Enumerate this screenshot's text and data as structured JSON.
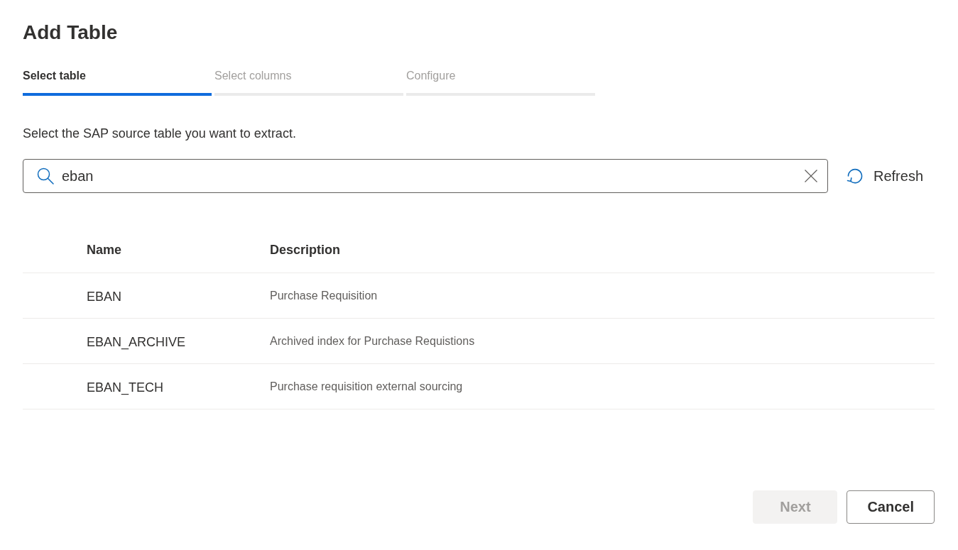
{
  "dialog": {
    "title": "Add Table"
  },
  "steps": [
    {
      "label": "Select table",
      "selected": true
    },
    {
      "label": "Select columns",
      "selected": false
    },
    {
      "label": "Configure",
      "selected": false
    }
  ],
  "instruction": "Select the SAP source table you want to extract.",
  "search": {
    "value": "eban"
  },
  "refresh_button": {
    "label": "Refresh"
  },
  "table": {
    "columns": [
      "Name",
      "Description"
    ],
    "rows": [
      {
        "name": "EBAN",
        "description": "Purchase Requisition"
      },
      {
        "name": "EBAN_ARCHIVE",
        "description": "Archived index for Purchase Requistions"
      },
      {
        "name": "EBAN_TECH",
        "description": "Purchase requisition external sourcing"
      }
    ]
  },
  "buttons": [
    {
      "label": "Next",
      "kind": "primary",
      "disabled": true
    },
    {
      "label": "Cancel",
      "kind": "secondary",
      "disabled": false
    }
  ]
}
